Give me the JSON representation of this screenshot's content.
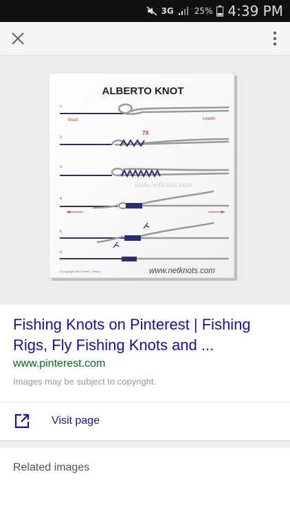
{
  "status_bar": {
    "network": "3G",
    "battery": "25%",
    "time": "4:39 PM"
  },
  "icons": {
    "close": "close-icon",
    "more": "more-vert-icon",
    "open_external": "open-in-new-icon"
  },
  "image": {
    "title": "ALBERTO KNOT",
    "braid_label": "Braid",
    "leader_label": "Leader",
    "wrap_label": "7X",
    "watermark": "www.netknots.com",
    "footer_url": "www.netknots.com",
    "copyright": "© Copyright 2014 John E. Sherry",
    "steps": [
      "1.",
      "2.",
      "3.",
      "4.",
      "5.",
      "6."
    ]
  },
  "result": {
    "title": "Fishing Knots on Pinterest | Fishing Rigs, Fly Fishing Knots and ...",
    "url": "www.pinterest.com",
    "note": "Images may be subject to copyright.",
    "visit_label": "Visit page"
  },
  "related": {
    "label": "Related images"
  },
  "colors": {
    "link": "#1a0dab",
    "url": "#006621",
    "braid": "#2c2a7a",
    "leader": "#9a9a9a",
    "arrow": "#e23b2e"
  }
}
